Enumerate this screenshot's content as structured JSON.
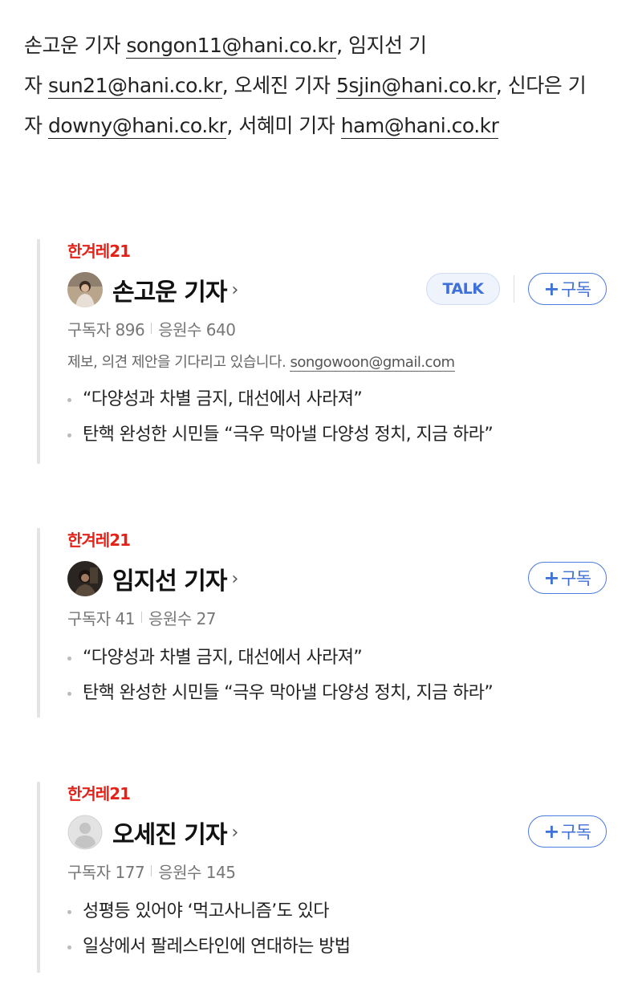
{
  "credits": {
    "line1_prefix": "손고운 기자 ",
    "email1": "songon11@hani.co.kr",
    "line1_suffix": ", 임지선 기",
    "line2_prefix": "자 ",
    "email2": "sun21@hani.co.kr",
    "line2_mid": ", 오세진 기자 ",
    "email3": "5sjin@hani.co.kr",
    "line2_suffix": ", 신다은 기",
    "line3_prefix": "자 ",
    "email4": "downy@hani.co.kr",
    "line3_mid": ", 서혜미 기자 ",
    "email5": "ham@hani.co.kr"
  },
  "reporters": [
    {
      "logo": "한겨레21",
      "name": "손고운 기자",
      "talk_label": "TALK",
      "subscribe_label": "구독",
      "subscribers_label": "구독자 896",
      "supporters_label": "응원수 640",
      "description": "제보, 의견 제안을 기다리고 있습니다. ",
      "description_email": "songowoon@gmail.com",
      "articles": [
        "“다양성과 차별 금지, 대선에서 사라져”",
        "탄핵 완성한 시민들 “극우 막아낼 다양성 정치, 지금 하라”"
      ]
    },
    {
      "logo": "한겨레21",
      "name": "임지선 기자",
      "subscribe_label": "구독",
      "subscribers_label": "구독자 41",
      "supporters_label": "응원수 27",
      "articles": [
        "“다양성과 차별 금지, 대선에서 사라져”",
        "탄핵 완성한 시민들 “극우 막아낼 다양성 정치, 지금 하라”"
      ]
    },
    {
      "logo": "한겨레21",
      "name": "오세진 기자",
      "subscribe_label": "구독",
      "subscribers_label": "구독자 177",
      "supporters_label": "응원수 145",
      "articles": [
        "성평등 있어야 ‘먹고사니즘’도 있다",
        "일상에서 팔레스타인에 연대하는 방법"
      ]
    }
  ],
  "colors": {
    "brand_red": "#e2231a",
    "accent_blue": "#3f6fd8"
  },
  "icons": {
    "chevron": "chevron-right-icon",
    "plus": "plus-icon",
    "avatar_placeholder": "user-placeholder-icon"
  }
}
